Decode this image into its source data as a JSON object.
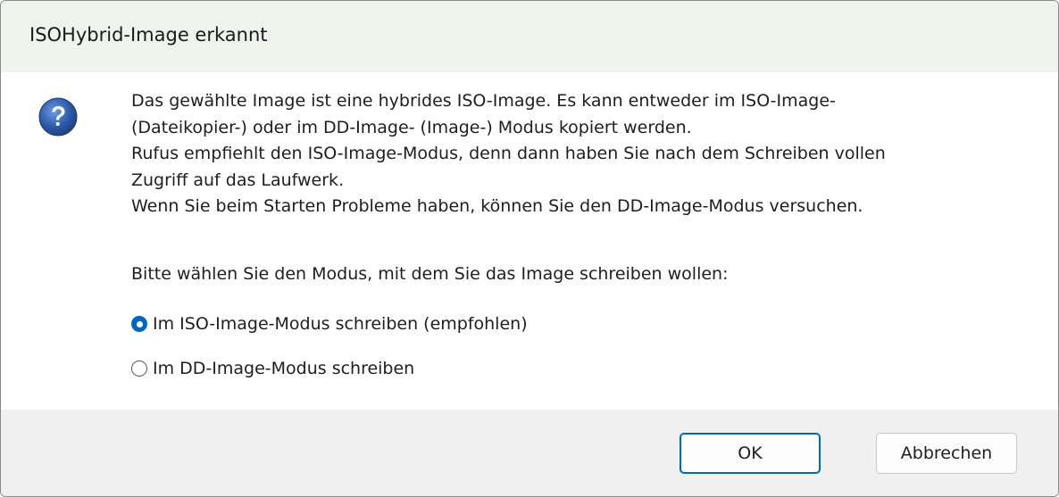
{
  "window": {
    "title": "ISOHybrid-Image erkannt"
  },
  "icon": {
    "name": "question-icon",
    "color": "#2c5aa8"
  },
  "message": {
    "lines": [
      "Das gewählte Image ist eine hybrides ISO-Image. Es kann entweder im ISO-Image-",
      "(Dateikopier-) oder im DD-Image- (Image-) Modus kopiert werden.",
      "Rufus empfiehlt den ISO-Image-Modus, denn dann haben Sie nach dem Schreiben vollen",
      "Zugriff auf das Laufwerk.",
      "Wenn Sie beim Starten Probleme haben, können Sie den DD-Image-Modus versuchen."
    ],
    "prompt": "Bitte wählen Sie den Modus, mit dem Sie das Image schreiben wollen:"
  },
  "options": [
    {
      "label": "Im ISO-Image-Modus schreiben (empfohlen)",
      "selected": true
    },
    {
      "label": "Im DD-Image-Modus schreiben",
      "selected": false
    }
  ],
  "buttons": {
    "ok_label": "OK",
    "cancel_label": "Abbrechen"
  },
  "colors": {
    "accent": "#0067c0",
    "titlebar_bg": "#eef4ec",
    "footer_bg": "#f0f0f0"
  }
}
